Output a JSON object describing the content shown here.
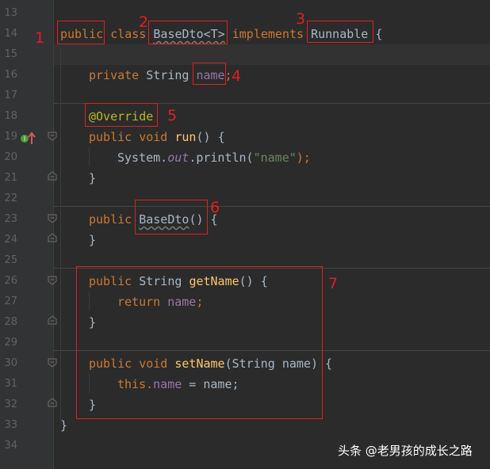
{
  "editor": {
    "line_numbers": [
      "13",
      "14",
      "15",
      "16",
      "17",
      "18",
      "19",
      "20",
      "21",
      "22",
      "23",
      "24",
      "25",
      "26",
      "27",
      "28",
      "29",
      "30",
      "31",
      "32",
      "33",
      "34"
    ],
    "code": {
      "public": "public",
      "class": "class",
      "class_name": "BaseDto",
      "type_param": "<T>",
      "implements": "implements",
      "interface": "Runnable",
      "open_brace": "{",
      "close_brace": "}",
      "private": "private",
      "string": "String",
      "field_name": "name",
      "semicolon": ";",
      "override": "@Override",
      "void": "void",
      "run": "run",
      "parens": "()",
      "system": "System.",
      "out": "out",
      "println": ".println(",
      "str_literal": "\"name\"",
      "close_call": ");",
      "ctor": "BaseDto",
      "getName": "getName",
      "return_kw": "return",
      "setName": "setName",
      "param_open": "(String name)",
      "this_kw": "this",
      "dot": ".",
      "assign": " = name;"
    }
  },
  "annotations": [
    "1",
    "2",
    "3",
    "4",
    "5",
    "6",
    "7"
  ],
  "watermark": "头条 @老男孩的成长之路",
  "colors": {
    "background": "#2b2b2b",
    "keyword": "#cc7832",
    "identifier": "#a9b7c6",
    "field": "#9876aa",
    "method": "#ffc66d",
    "string": "#6a8759",
    "annotation": "#bbb529",
    "markup_red": "#e02020"
  }
}
